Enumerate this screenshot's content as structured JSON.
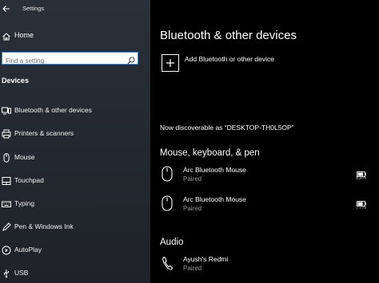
{
  "app": {
    "title": "Settings"
  },
  "sidebar": {
    "home_label": "Home",
    "search_placeholder": "Find a setting",
    "section_heading": "Devices",
    "items": [
      {
        "label": "Bluetooth & other devices",
        "icon": "bluetooth-devices-icon"
      },
      {
        "label": "Printers & scanners",
        "icon": "printer-icon"
      },
      {
        "label": "Mouse",
        "icon": "mouse-icon"
      },
      {
        "label": "Touchpad",
        "icon": "touchpad-icon"
      },
      {
        "label": "Typing",
        "icon": "keyboard-icon"
      },
      {
        "label": "Pen & Windows Ink",
        "icon": "pen-icon"
      },
      {
        "label": "AutoPlay",
        "icon": "autoplay-icon"
      },
      {
        "label": "USB",
        "icon": "usb-icon"
      }
    ]
  },
  "main": {
    "title": "Bluetooth & other devices",
    "add_label": "Add Bluetooth or other device",
    "discoverable": "Now discoverable as “DESKTOP-TH0L5OP”",
    "groups": [
      {
        "title": "Mouse, keyboard, & pen",
        "devices": [
          {
            "name": "Arc Bluetooth Mouse",
            "status": "Paired",
            "battery": "83%",
            "battery_level": 0.83,
            "icon": "mouse-icon"
          },
          {
            "name": "Arc Bluetooth Mouse",
            "status": "Paired",
            "battery": "77%",
            "battery_level": 0.77,
            "icon": "mouse-icon"
          }
        ]
      },
      {
        "title": "Audio",
        "devices": [
          {
            "name": "Ayush's Redmi",
            "status": "Paired",
            "icon": "phone-icon"
          }
        ]
      }
    ]
  }
}
